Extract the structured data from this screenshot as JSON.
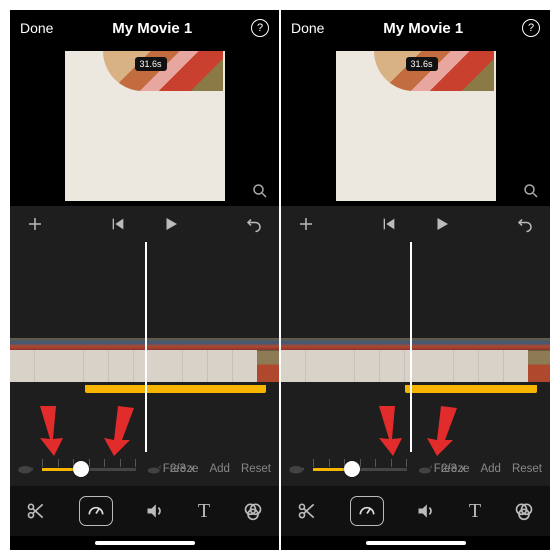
{
  "colors": {
    "accent": "#f7b500",
    "arrow": "#e22b2b"
  },
  "left": {
    "header": {
      "done": "Done",
      "title": "My Movie 1"
    },
    "preview": {
      "duration_badge": "31.6s"
    },
    "speed": {
      "label": "2/3 x",
      "freeze": "Freeze",
      "add": "Add",
      "reset": "Reset",
      "knob_pct": 42,
      "fill_pct": 42,
      "bar_left_pct": 28,
      "bar_right_pct": 5,
      "playhead_pct": 50
    }
  },
  "right": {
    "header": {
      "done": "Done",
      "title": "My Movie 1"
    },
    "preview": {
      "duration_badge": "31.6s"
    },
    "speed": {
      "label": "2/3 x",
      "freeze": "Freeze",
      "add": "Add",
      "reset": "Reset",
      "knob_pct": 42,
      "fill_pct": 42,
      "bar_left_pct": 46,
      "bar_right_pct": 5,
      "playhead_pct": 48
    }
  }
}
